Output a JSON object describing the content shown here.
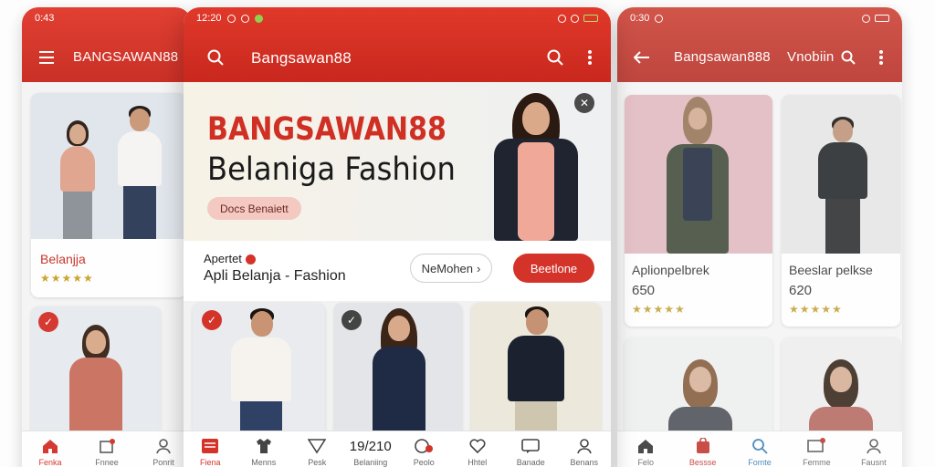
{
  "left_phone": {
    "status_time": "0:43",
    "title": "BANGSAWAN88",
    "product": {
      "name": "Belanjja",
      "stars": "★★★★★"
    },
    "nav": [
      {
        "label": "Fenka",
        "icon": "home-icon",
        "active": true
      },
      {
        "label": "Fnnee",
        "icon": "bag-icon",
        "active": false
      },
      {
        "label": "Ponrit",
        "icon": "profile-icon",
        "active": false
      }
    ]
  },
  "center_phone": {
    "status_time": "12:20",
    "title": "Bangsawan88",
    "hero": {
      "brand": "BANGSAWAN88",
      "tagline": "Belaniga Fashion",
      "cta": "Docs Benaiett"
    },
    "info": {
      "small_label": "Apertet",
      "main_label": "Apli Belanja - Fashion",
      "button_outline": "NeMohen",
      "button_solid": "Beetlone"
    },
    "nav": [
      {
        "label": "Fiena",
        "icon": "shop-icon",
        "active": true
      },
      {
        "label": "Menns",
        "icon": "shirt-icon",
        "active": false
      },
      {
        "label": "Pesk",
        "icon": "tag-icon",
        "active": false
      },
      {
        "label": "Belaniing",
        "icon": "",
        "value": "19/210",
        "active": false
      },
      {
        "label": "Peolo",
        "icon": "cart-icon",
        "active": false
      },
      {
        "label": "Hhtel",
        "icon": "heart-icon",
        "active": false
      },
      {
        "label": "Banade",
        "icon": "chat-icon",
        "active": false
      },
      {
        "label": "Benans",
        "icon": "profile-icon",
        "active": false
      }
    ]
  },
  "right_phone": {
    "status_time": "0:30",
    "title": "Bangsawan888",
    "title_right": "Vnobiin",
    "products": [
      {
        "name": "Aplionpelbrek",
        "price": "650",
        "stars": "★★★★★"
      },
      {
        "name": "Beeslar pelkse",
        "price": "620",
        "stars": "★★★★★"
      }
    ],
    "nav": [
      {
        "label": "Felo",
        "icon": "home-icon",
        "active": false
      },
      {
        "label": "Bessse",
        "icon": "bag-icon",
        "active": true
      },
      {
        "label": "Fomte",
        "icon": "search-icon",
        "active": false
      },
      {
        "label": "Femme",
        "icon": "cart-icon",
        "active": false
      },
      {
        "label": "Fausnt",
        "icon": "profile-icon",
        "active": false
      }
    ]
  },
  "colors": {
    "primary": "#d4332a",
    "star": "#c9a227"
  }
}
